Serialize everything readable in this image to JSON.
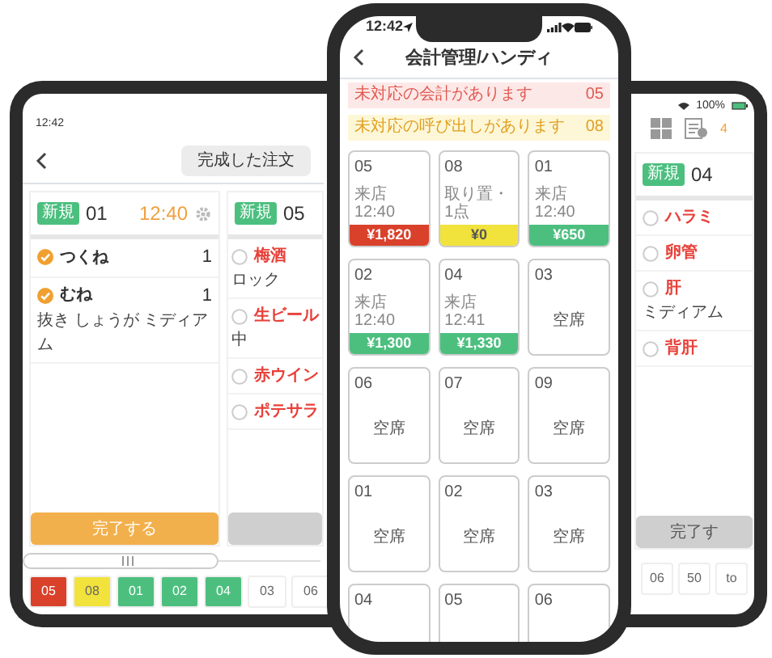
{
  "left_tablet": {
    "status_time": "12:42",
    "segment": "完成した注文",
    "orders": [
      {
        "badge": "新規",
        "table": "01",
        "time": "12:40",
        "button": "完了する",
        "disabled": false,
        "items": [
          {
            "name": "つくね",
            "qty": "1",
            "checked": true
          },
          {
            "name": "むね",
            "qty": "1",
            "checked": true,
            "note": "抜き しょうが ミディアム"
          }
        ]
      },
      {
        "badge": "新規",
        "table": "05",
        "disabled": true,
        "items": [
          {
            "name": "梅酒",
            "checked": false,
            "note": "ロック"
          },
          {
            "name": "生ビール",
            "checked": false,
            "note": "中"
          },
          {
            "name": "赤ウイン",
            "checked": false
          },
          {
            "name": "ポテサラ",
            "checked": false
          }
        ]
      }
    ],
    "tables": [
      {
        "label": "05",
        "color": "#d9412b"
      },
      {
        "label": "08",
        "color": "#f1e23c"
      },
      {
        "label": "01",
        "color": "#4cbf7f"
      },
      {
        "label": "02",
        "color": "#4cbf7f"
      },
      {
        "label": "04",
        "color": "#4cbf7f"
      },
      {
        "label": "03",
        "color": "#ffffff"
      },
      {
        "label": "06",
        "color": "#ffffff"
      }
    ]
  },
  "phone": {
    "status_time": "12:42",
    "title": "会計管理/ハンディ",
    "alerts": [
      {
        "kind": "bill",
        "text": "未対応の会計があります",
        "count": "05"
      },
      {
        "kind": "call",
        "text": "未対応の呼び出しがあります",
        "count": "08"
      }
    ],
    "tables": [
      {
        "number": "05",
        "kind": "occupied",
        "detail": "来店 12:40",
        "amount": "¥1,820",
        "color": "#d9412b"
      },
      {
        "number": "08",
        "kind": "occupied",
        "detail": "取り置・1点",
        "amount": "¥0",
        "color": "#f1e23c"
      },
      {
        "number": "01",
        "kind": "occupied",
        "detail": "来店 12:40",
        "amount": "¥650",
        "color": "#4cbf7f"
      },
      {
        "number": "02",
        "kind": "occupied",
        "detail": "来店 12:40",
        "amount": "¥1,300",
        "color": "#4cbf7f"
      },
      {
        "number": "04",
        "kind": "occupied",
        "detail": "来店 12:41",
        "amount": "¥1,330",
        "color": "#4cbf7f"
      },
      {
        "number": "03",
        "kind": "vacant",
        "detail": "空席"
      },
      {
        "number": "06",
        "kind": "vacant",
        "detail": "空席"
      },
      {
        "number": "07",
        "kind": "vacant",
        "detail": "空席"
      },
      {
        "number": "09",
        "kind": "vacant",
        "detail": "空席"
      },
      {
        "number": "01",
        "kind": "vacant",
        "detail": "空席"
      },
      {
        "number": "02",
        "kind": "vacant",
        "detail": "空席"
      },
      {
        "number": "03",
        "kind": "vacant",
        "detail": "空席"
      },
      {
        "number": "04",
        "kind": "vacant"
      },
      {
        "number": "05",
        "kind": "vacant"
      },
      {
        "number": "06",
        "kind": "vacant"
      }
    ]
  },
  "right_tablet": {
    "battery": "100%",
    "pending_count": "4",
    "orders": [
      {
        "badge": "新規",
        "table": "04",
        "button": "完了す",
        "disabled": true,
        "items": [
          {
            "name": "ハラミ",
            "checked": false
          },
          {
            "name": "卵管",
            "checked": false
          },
          {
            "name": "肝",
            "checked": false,
            "note": "ミディアム"
          },
          {
            "name": "背肝",
            "checked": false
          }
        ]
      }
    ],
    "tables": [
      {
        "label": "06",
        "color": "#ffffff"
      },
      {
        "label": "50",
        "color": "#ffffff"
      },
      {
        "label": "to",
        "color": "#ffffff"
      }
    ]
  }
}
